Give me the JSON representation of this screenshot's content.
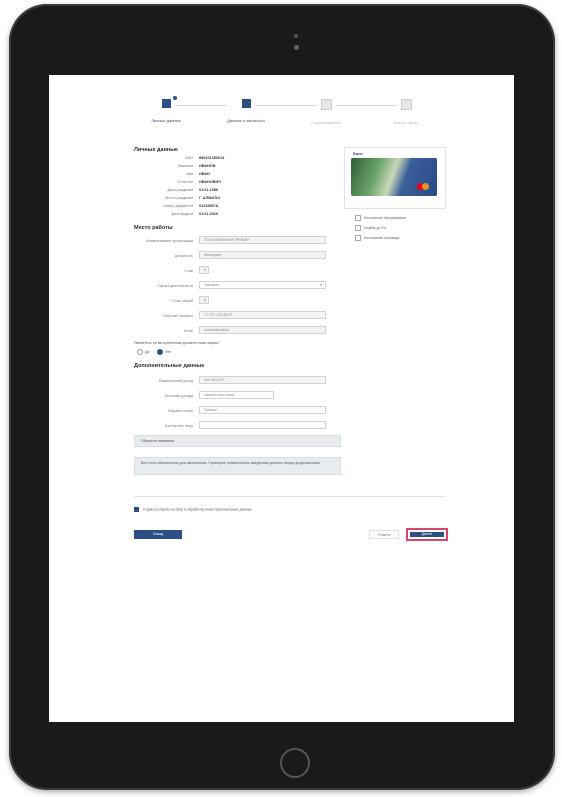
{
  "stepper": {
    "steps": [
      {
        "label": "Личные данные",
        "state": "done"
      },
      {
        "label": "Данные о занятости",
        "state": "active"
      },
      {
        "label": "Подтверждение",
        "state": "pending"
      },
      {
        "label": "Выбор карты",
        "state": "pending"
      }
    ]
  },
  "personal": {
    "title": "Личные данные",
    "rows": [
      {
        "label": "ИИН",
        "value": "890101350614"
      },
      {
        "label": "Фамилия",
        "value": "ИВАНОВ"
      },
      {
        "label": "Имя",
        "value": "ИВАН"
      },
      {
        "label": "Отчество",
        "value": "ИВАНОВИЧ"
      },
      {
        "label": "Дата рождения",
        "value": "01.01.1989"
      },
      {
        "label": "Место рождения",
        "value": "Г. АЛМАТЫ"
      },
      {
        "label": "Номер документа",
        "value": "012345678"
      },
      {
        "label": "Дата выдачи",
        "value": "01.01.2020"
      }
    ]
  },
  "work": {
    "title": "Место работы",
    "fields": [
      {
        "label": "Наименование организации",
        "value": "ТОО КОМПАНИЯ ПРИМЕР",
        "type": "field"
      },
      {
        "label": "Должность",
        "value": "Менеджер",
        "type": "field"
      },
      {
        "label": "Стаж",
        "value": "5",
        "type": "small"
      },
      {
        "label": "Сфера деятельности",
        "value": "Торговля",
        "type": "select"
      },
      {
        "label": "Стаж общий",
        "value": "8",
        "type": "small"
      },
      {
        "label": "Рабочий телефон",
        "value": "+7 777 123 45 67",
        "type": "field"
      },
      {
        "label": "Email",
        "value": "ivanov@mail.kz",
        "type": "field"
      }
    ],
    "question": "Являетесь ли вы публичным должностным лицом?",
    "radio_yes": "Да",
    "radio_no": "Нет"
  },
  "income": {
    "title": "Дополнительные данные",
    "fields": [
      {
        "label": "Ежемесячный доход",
        "value": "350 000 KZT"
      },
      {
        "label": "Источник дохода",
        "value": "Заработная плата"
      },
      {
        "label": "Кодовое слово",
        "value": "Пример"
      },
      {
        "label": "Контактное лицо",
        "value": ""
      }
    ],
    "box1": "Обратите внимание",
    "box2": "Все поля обязательны для заполнения. Проверьте правильность введённых данных перед продолжением."
  },
  "card_panel": {
    "brand": "Банк",
    "options": [
      "Бесплатное обслуживание",
      "Кэшбэк до 5%",
      "Бесплатные переводы"
    ]
  },
  "consent": "Я даю согласие на сбор и обработку моих персональных данных",
  "buttons": {
    "back": "Назад",
    "cancel": "Отмена",
    "next": "Далее"
  }
}
